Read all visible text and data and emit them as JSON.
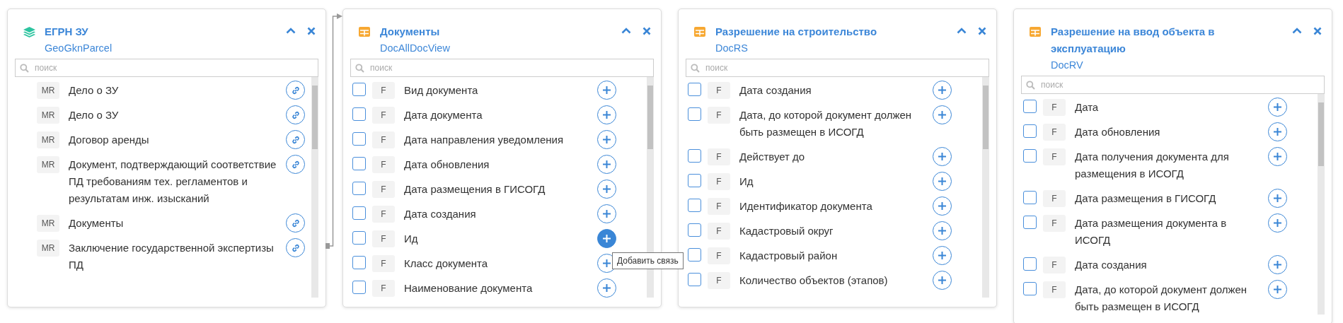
{
  "panels": [
    {
      "kind": "layers",
      "title": "ЕГРН ЗУ",
      "subtitle": "GeoGknParcel",
      "search": {
        "placeholder": "поиск"
      },
      "items": [
        {
          "kind": "link",
          "badge": "MR",
          "label": "Дело о ЗУ"
        },
        {
          "kind": "link",
          "badge": "MR",
          "label": "Дело о ЗУ"
        },
        {
          "kind": "link",
          "badge": "MR",
          "label": "Договор аренды"
        },
        {
          "kind": "link",
          "badge": "MR",
          "label": "Документ, подтверждающий соответствие ПД требованиям тех. регламентов и результатам инж. изысканий"
        },
        {
          "kind": "link",
          "badge": "MR",
          "label": "Документы"
        },
        {
          "kind": "link",
          "badge": "MR",
          "label": "Заключение государственной экспертизы ПД"
        }
      ]
    },
    {
      "kind": "table",
      "title": "Документы",
      "subtitle": "DocAllDocView",
      "search": {
        "placeholder": "поиск"
      },
      "items": [
        {
          "kind": "field",
          "checked": false,
          "badge": "F",
          "label": "Вид документа",
          "hovered": false
        },
        {
          "kind": "field",
          "checked": false,
          "badge": "F",
          "label": "Дата документа",
          "hovered": false
        },
        {
          "kind": "field",
          "checked": false,
          "badge": "F",
          "label": "Дата направления уведомления",
          "hovered": false
        },
        {
          "kind": "field",
          "checked": false,
          "badge": "F",
          "label": "Дата обновления",
          "hovered": false
        },
        {
          "kind": "field",
          "checked": false,
          "badge": "F",
          "label": "Дата размещения в ГИСОГД",
          "hovered": false
        },
        {
          "kind": "field",
          "checked": false,
          "badge": "F",
          "label": "Дата создания",
          "hovered": false
        },
        {
          "kind": "field",
          "checked": false,
          "badge": "F",
          "label": "Ид",
          "hovered": true,
          "tooltip": "Добавить связь"
        },
        {
          "kind": "field",
          "checked": false,
          "badge": "F",
          "label": "Класс документа",
          "hovered": false
        },
        {
          "kind": "field",
          "checked": false,
          "badge": "F",
          "label": "Наименование документа",
          "hovered": false
        }
      ]
    },
    {
      "kind": "table",
      "title": "Разрешение на строительство",
      "subtitle": "DocRS",
      "search": {
        "placeholder": "поиск"
      },
      "items": [
        {
          "kind": "field",
          "checked": false,
          "badge": "F",
          "label": "Дата создания",
          "hovered": false
        },
        {
          "kind": "field",
          "checked": false,
          "badge": "F",
          "label": "Дата, до которой документ должен быть размещен в ИСОГД",
          "hovered": false
        },
        {
          "kind": "field",
          "checked": false,
          "badge": "F",
          "label": "Действует до",
          "hovered": false
        },
        {
          "kind": "field",
          "checked": false,
          "badge": "F",
          "label": "Ид",
          "hovered": false
        },
        {
          "kind": "field",
          "checked": false,
          "badge": "F",
          "label": "Идентификатор документа",
          "hovered": false
        },
        {
          "kind": "field",
          "checked": false,
          "badge": "F",
          "label": "Кадастровый округ",
          "hovered": false
        },
        {
          "kind": "field",
          "checked": false,
          "badge": "F",
          "label": "Кадастровый район",
          "hovered": false
        },
        {
          "kind": "field",
          "checked": false,
          "badge": "F",
          "label": "Количество объектов (этапов)",
          "hovered": false
        }
      ]
    },
    {
      "kind": "table",
      "title": "Разрешение на ввод объекта в эксплуатацию",
      "subtitle": "DocRV",
      "search": {
        "placeholder": "поиск"
      },
      "items": [
        {
          "kind": "field",
          "checked": false,
          "badge": "F",
          "label": "Дата",
          "hovered": false
        },
        {
          "kind": "field",
          "checked": false,
          "badge": "F",
          "label": "Дата обновления",
          "hovered": false
        },
        {
          "kind": "field",
          "checked": false,
          "badge": "F",
          "label": "Дата получения документа для размещения в ИСОГД",
          "hovered": false
        },
        {
          "kind": "field",
          "checked": false,
          "badge": "F",
          "label": "Дата размещения в ГИСОГД",
          "hovered": false
        },
        {
          "kind": "field",
          "checked": false,
          "badge": "F",
          "label": "Дата размещения документа в ИСОГД",
          "hovered": false
        },
        {
          "kind": "field",
          "checked": false,
          "badge": "F",
          "label": "Дата создания",
          "hovered": false
        },
        {
          "kind": "field",
          "checked": false,
          "badge": "F",
          "label": "Дата, до которой документ должен быть размещен в ИСОГД",
          "hovered": false
        }
      ]
    }
  ]
}
